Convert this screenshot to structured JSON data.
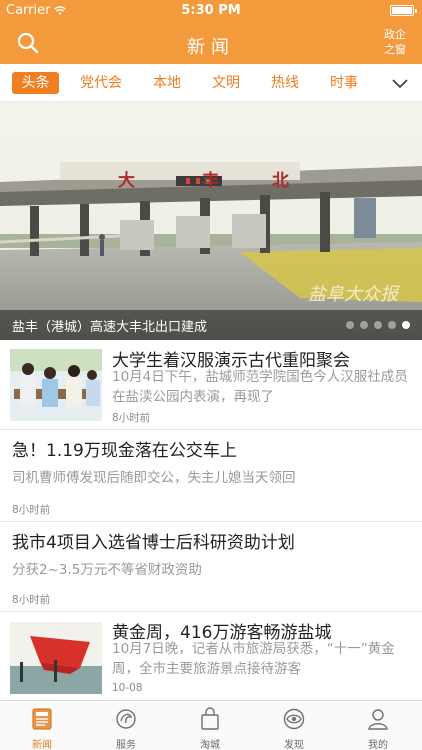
{
  "status": {
    "carrier": "Carrier",
    "time": "5:30 PM",
    "battery_level": 1.0
  },
  "nav": {
    "title": "新闻",
    "right_line1": "政企",
    "right_line2": "之窗"
  },
  "tabs": [
    {
      "label": "头条",
      "active": true
    },
    {
      "label": "党代会"
    },
    {
      "label": "本地"
    },
    {
      "label": "文明"
    },
    {
      "label": "热线"
    },
    {
      "label": "时事"
    }
  ],
  "banner": {
    "caption": "盐丰（港城）高速大丰北出口建成",
    "sign_chars": [
      "大",
      "丰",
      "北"
    ],
    "watermark": "盐阜大众报",
    "dot_count": 5,
    "active_dot": 5
  },
  "news": [
    {
      "headline": "大学生着汉服演示古代重阳聚会",
      "summary": "10月4日下午，盐城师范学院国色今人汉服社成员在盐渎公园内表演，再现了",
      "time": "8小时前",
      "has_thumb": true
    },
    {
      "headline": "急！1.19万现金落在公交车上",
      "summary": "司机曹师傅发现后随即交公，失主儿媳当天领回",
      "time": "8小时前",
      "has_thumb": false
    },
    {
      "headline": "我市4项目入选省博士后科研资助计划",
      "summary": "分获2~3.5万元不等省财政资助",
      "time": "8小时前",
      "has_thumb": false
    },
    {
      "headline": "黄金周，416万游客畅游盐城",
      "summary": "10月7日晚，记者从市旅游局获悉，“十一”黄金周，全市主要旅游景点接待游客",
      "time": "10-08",
      "has_thumb": true
    }
  ],
  "tabbar": [
    {
      "label": "新闻",
      "icon": "news-icon",
      "active": true
    },
    {
      "label": "服务",
      "icon": "service-icon"
    },
    {
      "label": "淘城",
      "icon": "shopping-bag-icon"
    },
    {
      "label": "发现",
      "icon": "discover-eye-icon"
    },
    {
      "label": "我的",
      "icon": "profile-icon"
    }
  ],
  "colors": {
    "brand": "#f39a3d",
    "tab_active": "#f07f22",
    "tab_text": "#ee7d22"
  }
}
